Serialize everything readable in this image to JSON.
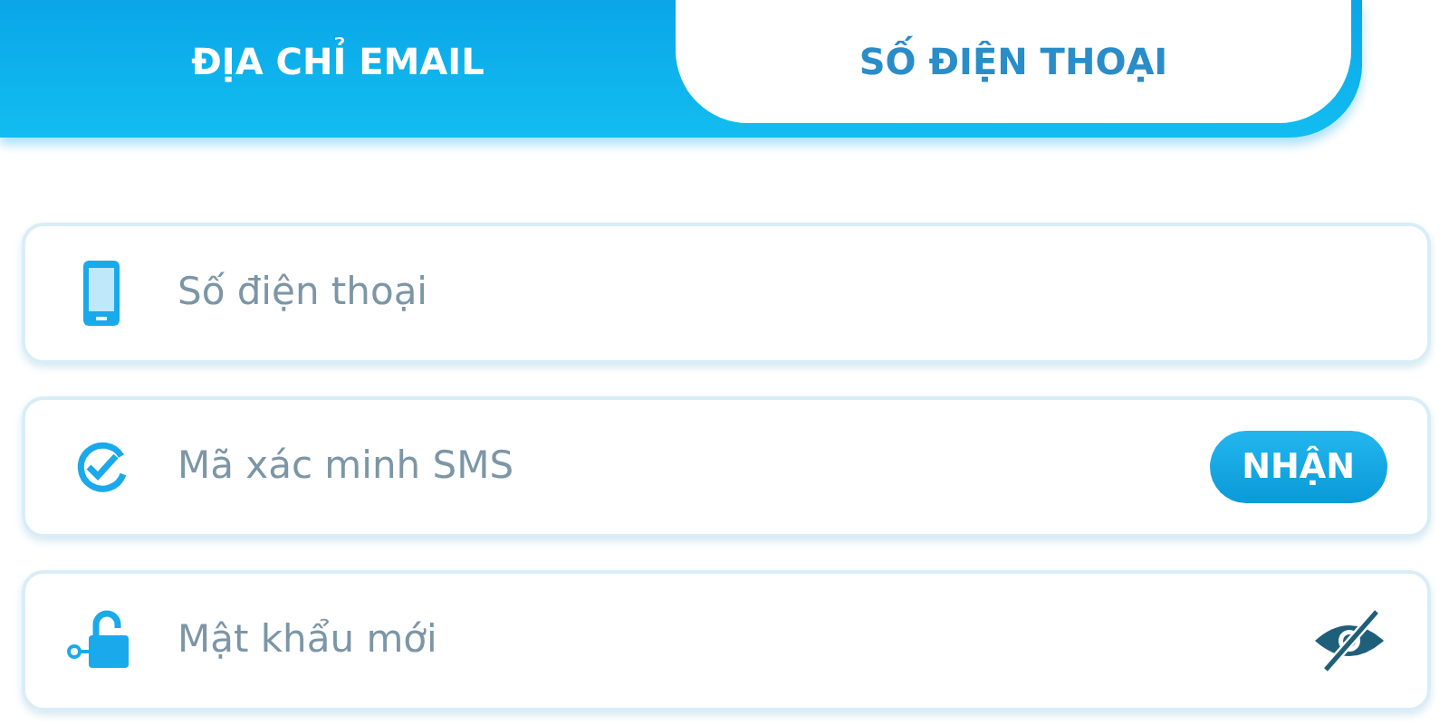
{
  "tabs": [
    {
      "label": "ĐỊA CHỈ EMAIL",
      "selected": false
    },
    {
      "label": "SỐ ĐIỆN THOẠI",
      "selected": true
    }
  ],
  "fields": [
    {
      "kind": "phone",
      "placeholder": "Số điện thoại"
    },
    {
      "kind": "sms",
      "placeholder": "Mã xác minh SMS",
      "button": "NHẬN"
    },
    {
      "kind": "password",
      "placeholder": "Mật khẩu mới"
    }
  ]
}
